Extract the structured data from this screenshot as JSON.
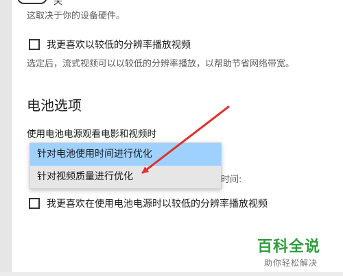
{
  "header": {
    "toggle_state": "关",
    "hardware_note": "这取决于你的设备硬件。"
  },
  "video_quality": {
    "checkbox_label": "我更喜欢以较低的分辨率播放视频",
    "checked": false,
    "description": "选定后，流式视频可以以较低的分辨率播放，以帮助节省网络带宽。"
  },
  "battery": {
    "section_title": "电池选项",
    "dropdown_label": "使用电池电源观看电影和视频时",
    "options": [
      "针对电池使用时间进行优化",
      "针对视频质量进行优化"
    ],
    "selected_index": 0,
    "hover_index": 1,
    "obscured_suffix": "时间:",
    "checkbox_label": "我更喜欢在使用电池电源时以较低的分辨率播放视频",
    "checked": false
  },
  "annotation": {
    "arrow_color": "#e0322e"
  },
  "watermark": {
    "title": "百科全说",
    "subtitle": "助你轻松解决"
  },
  "colors": {
    "selected_option_bg": "#9fd1ff",
    "hover_option_bg": "#e6e6e6",
    "watermark_green": "#2e9e3e"
  }
}
